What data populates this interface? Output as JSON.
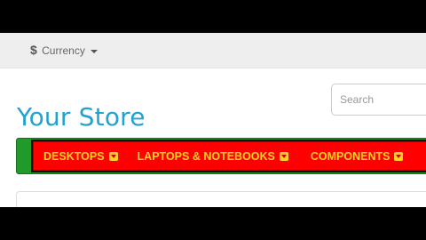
{
  "topbar": {
    "currency_symbol": "$",
    "currency_label": "Currency"
  },
  "header": {
    "logo_text": "Your Store",
    "search_placeholder": "Search"
  },
  "menu": {
    "items": [
      {
        "label": "DESKTOPS"
      },
      {
        "label": "LAPTOPS & NOTEBOOKS"
      },
      {
        "label": "COMPONENTS"
      }
    ]
  },
  "colors": {
    "menu_background": "#ff0000",
    "menu_text": "#ffd21f",
    "menu_border_accent": "#229a2a",
    "logo": "#23a1d1"
  }
}
